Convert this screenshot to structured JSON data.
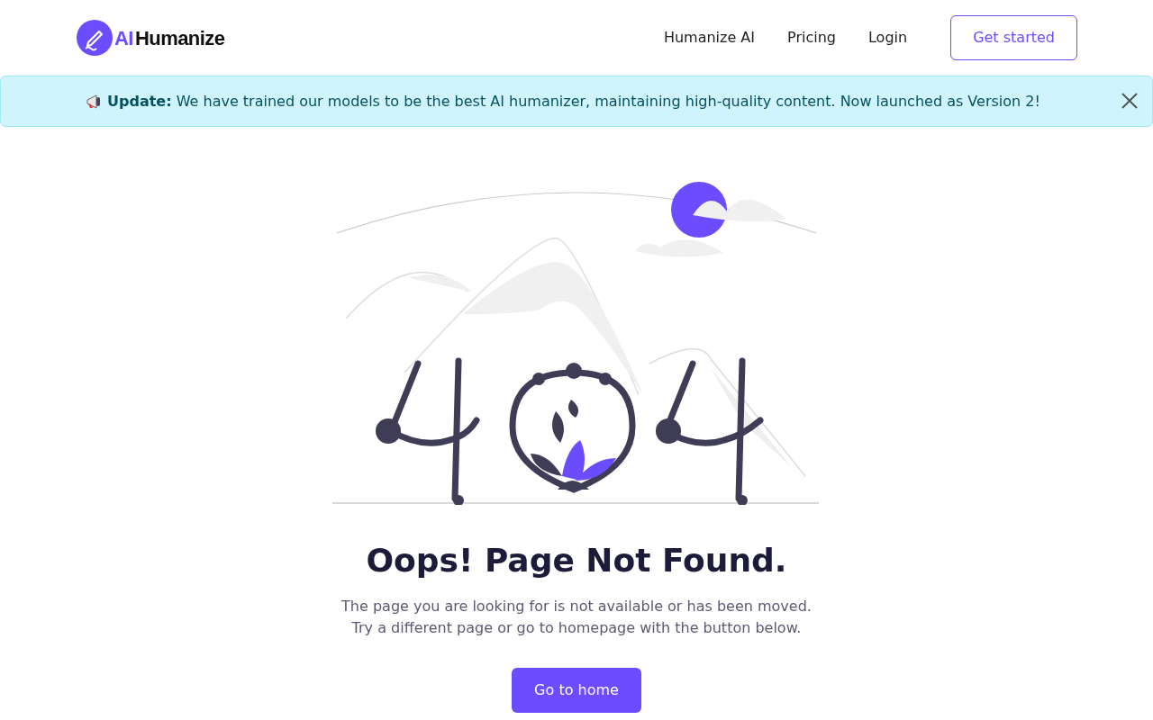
{
  "header": {
    "logo": {
      "accent": "AI",
      "text": "Humanize"
    },
    "nav": [
      {
        "label": "Humanize AI"
      },
      {
        "label": "Pricing"
      },
      {
        "label": "Login"
      }
    ],
    "cta": "Get started"
  },
  "banner": {
    "message": "**Update:** We have trained our models to be the best AI humanizer, maintaining high-quality content. Now launched as Version 2!",
    "dismissible": true
  },
  "error": {
    "title": "Oops! Page Not Found.",
    "lines": [
      "The page you are looking for is not available or has been moved.",
      "Try a different page or go to homepage with the button below."
    ],
    "button": "Go to home"
  }
}
